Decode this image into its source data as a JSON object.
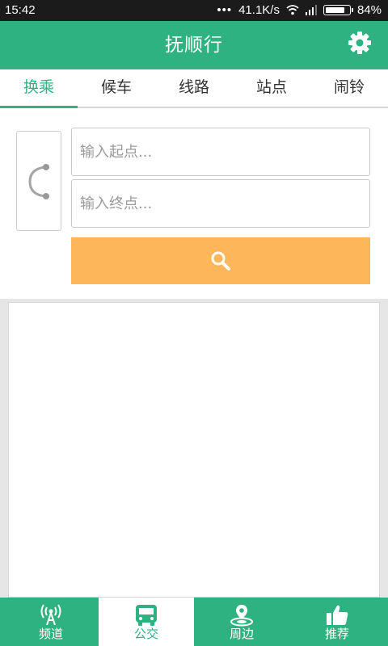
{
  "status": {
    "time": "15:42",
    "network_speed": "41.1K/s",
    "battery": "84%",
    "battery_level": 0.84
  },
  "header": {
    "title": "抚顺行"
  },
  "tabs": [
    {
      "label": "换乘"
    },
    {
      "label": "候车"
    },
    {
      "label": "线路"
    },
    {
      "label": "站点"
    },
    {
      "label": "闹铃"
    }
  ],
  "form": {
    "start_placeholder": "输入起点...",
    "end_placeholder": "输入终点..."
  },
  "bottom_nav": [
    {
      "label": "频道"
    },
    {
      "label": "公交"
    },
    {
      "label": "周边"
    },
    {
      "label": "推荐"
    }
  ],
  "colors": {
    "primary": "#2fb282",
    "search": "#fdb75a"
  }
}
